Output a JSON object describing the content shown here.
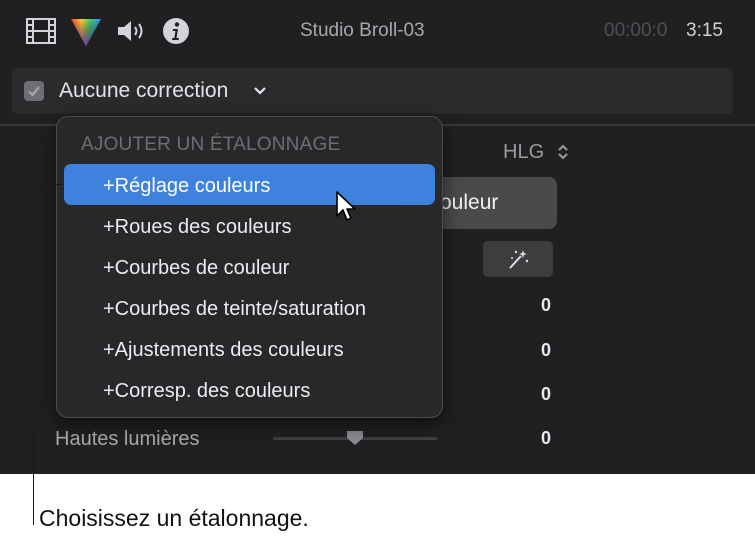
{
  "toolbar": {
    "icons": [
      "video-inspector-icon",
      "color-inspector-icon",
      "audio-inspector-icon",
      "info-inspector-icon"
    ],
    "title": "Studio Broll-03",
    "timecode_dim": "00:00:0",
    "timecode_bright": "3:15"
  },
  "correction": {
    "checked": true,
    "label": "Aucune correction"
  },
  "inspector": {
    "hlg_label": "HLG",
    "button_label": "ouleur",
    "values": [
      "0",
      "0",
      "0",
      "0"
    ],
    "highlights_label": "Hautes lumières"
  },
  "menu": {
    "header": "AJOUTER UN ÉTALONNAGE",
    "items": [
      "+Réglage couleurs",
      "+Roues des couleurs",
      "+Courbes de couleur",
      "+Courbes de teinte/saturation",
      "+Ajustements des couleurs",
      "+Corresp. des couleurs"
    ],
    "selected_index": 0
  },
  "callout": {
    "text": "Choisissez un étalonnage."
  },
  "colors": {
    "panel_bg": "#202022",
    "menu_highlight": "#3e82dd"
  }
}
